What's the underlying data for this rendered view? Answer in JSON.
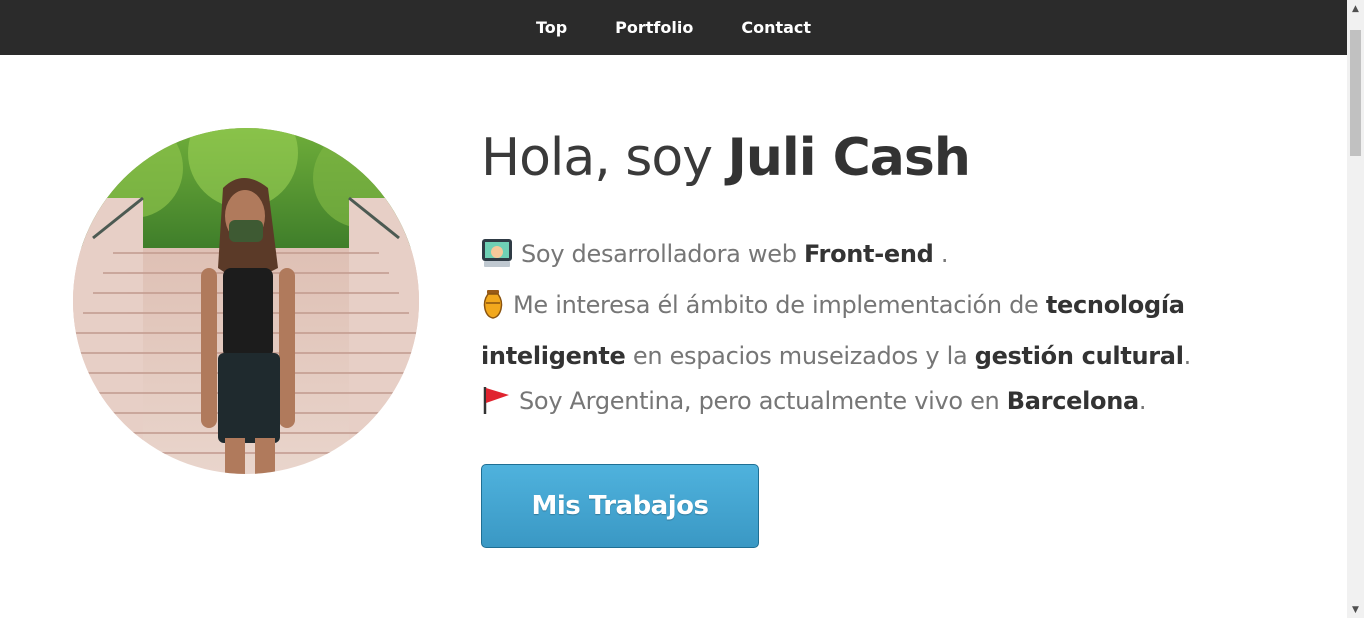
{
  "nav": {
    "items": [
      {
        "label": "Top"
      },
      {
        "label": "Portfolio"
      },
      {
        "label": "Contact"
      }
    ]
  },
  "hero": {
    "greeting": "Hola, soy",
    "name": "Juli Cash",
    "bio": {
      "line1": {
        "icon": "computer-emoji-icon",
        "prefix": "Soy desarrolladora web",
        "bold": "Front-end",
        "suffix": "."
      },
      "line2": {
        "icon": "amphora-emoji-icon",
        "prefix": "Me interesa él ámbito de implementación de",
        "bold1": "tecnología inteligente",
        "middle": "en espacios museizados y la",
        "bold2": "gestión cultural",
        "suffix": "."
      },
      "line3": {
        "icon": "red-flag-emoji-icon",
        "prefix": "Soy Argentina, pero actualmente vivo en",
        "bold": "Barcelona",
        "suffix": "."
      }
    },
    "cta_label": "Mis Trabajos"
  },
  "colors": {
    "nav_bg": "#2b2b2b",
    "button_bg": "#43a5d2",
    "text_dark": "#333333",
    "text_light": "#767676"
  }
}
